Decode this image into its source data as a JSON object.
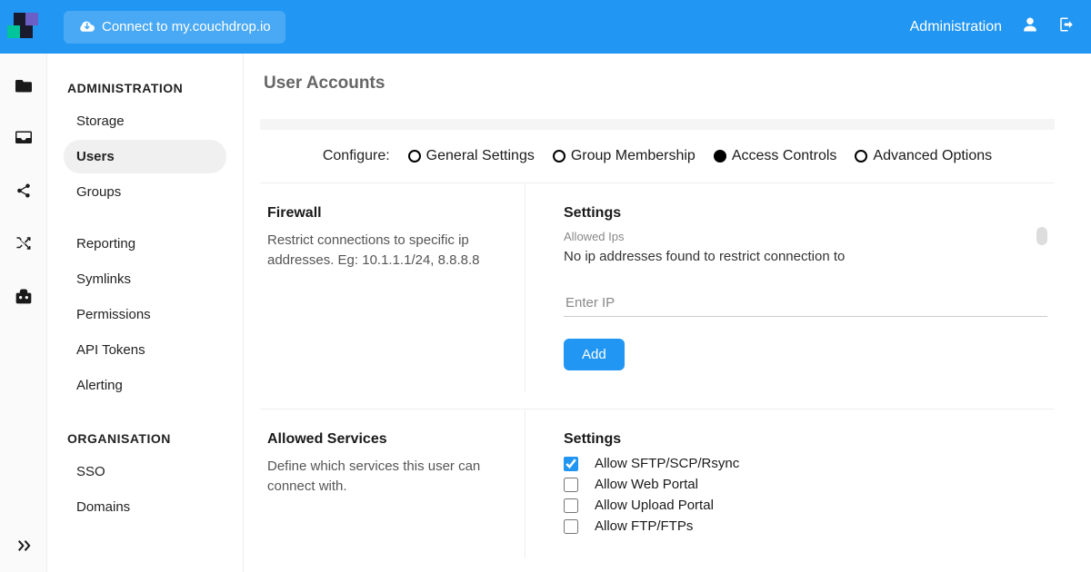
{
  "topbar": {
    "connect_label": "Connect to my.couchdrop.io",
    "admin_link": "Administration"
  },
  "sidebar": {
    "heading_admin": "ADMINISTRATION",
    "heading_org": "ORGANISATION",
    "items_admin": [
      {
        "label": "Storage"
      },
      {
        "label": "Users"
      },
      {
        "label": "Groups"
      },
      {
        "label": "Reporting"
      },
      {
        "label": "Symlinks"
      },
      {
        "label": "Permissions"
      },
      {
        "label": "API Tokens"
      },
      {
        "label": "Alerting"
      }
    ],
    "items_org": [
      {
        "label": "SSO"
      },
      {
        "label": "Domains"
      }
    ]
  },
  "page": {
    "title": "User Accounts",
    "configure_label": "Configure:",
    "tabs": [
      {
        "label": "General Settings"
      },
      {
        "label": "Group Membership"
      },
      {
        "label": "Access Controls"
      },
      {
        "label": "Advanced Options"
      }
    ]
  },
  "firewall": {
    "heading": "Firewall",
    "desc": "Restrict connections to specific ip addresses. Eg: 10.1.1.1/24, 8.8.8.8",
    "settings_heading": "Settings",
    "allowed_ips_label": "Allowed Ips",
    "empty_text": "No ip addresses found to restrict connection to",
    "ip_placeholder": "Enter IP",
    "add_label": "Add"
  },
  "services": {
    "heading": "Allowed Services",
    "desc": "Define which services this user can connect with.",
    "settings_heading": "Settings",
    "options": [
      {
        "label": "Allow SFTP/SCP/Rsync",
        "checked": true
      },
      {
        "label": "Allow Web Portal",
        "checked": false
      },
      {
        "label": "Allow Upload Portal",
        "checked": false
      },
      {
        "label": "Allow FTP/FTPs",
        "checked": false
      }
    ]
  }
}
